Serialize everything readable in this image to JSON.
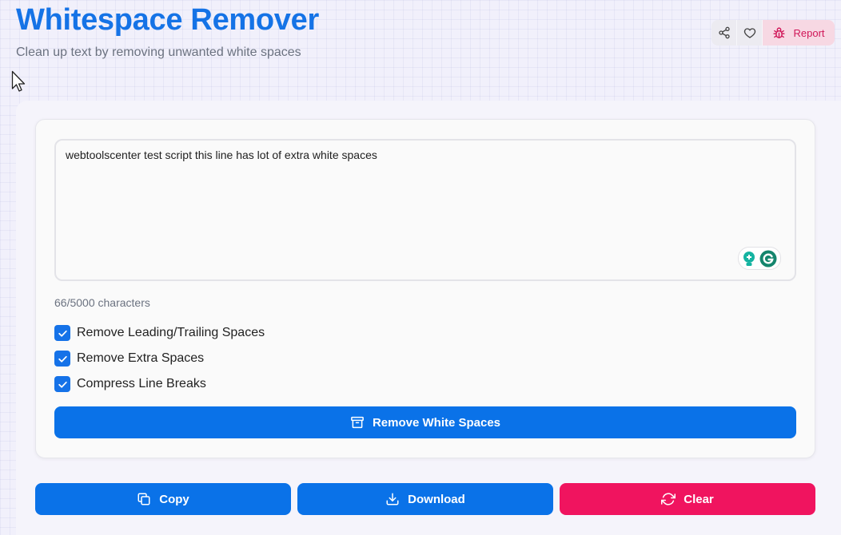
{
  "header": {
    "title": "Whitespace Remover",
    "subtitle": "Clean up text by removing unwanted white spaces",
    "actions": {
      "share_icon": "share-icon",
      "favorite_icon": "heart-icon",
      "report_label": "Report",
      "report_icon": "bug-icon"
    }
  },
  "editor": {
    "value": "webtoolscenter test script this line has lot of extra white spaces",
    "char_count": "66/5000 characters"
  },
  "options": [
    {
      "label": "Remove Leading/Trailing Spaces",
      "checked": true
    },
    {
      "label": "Remove Extra Spaces",
      "checked": true
    },
    {
      "label": "Compress Line Breaks",
      "checked": true
    }
  ],
  "primary_action": {
    "label": "Remove White Spaces",
    "icon": "archive-icon"
  },
  "actions": {
    "copy_label": "Copy",
    "download_label": "Download",
    "clear_label": "Clear"
  },
  "colors": {
    "accent": "#0a72e8",
    "danger": "#f0145f",
    "title": "#1573e6"
  }
}
